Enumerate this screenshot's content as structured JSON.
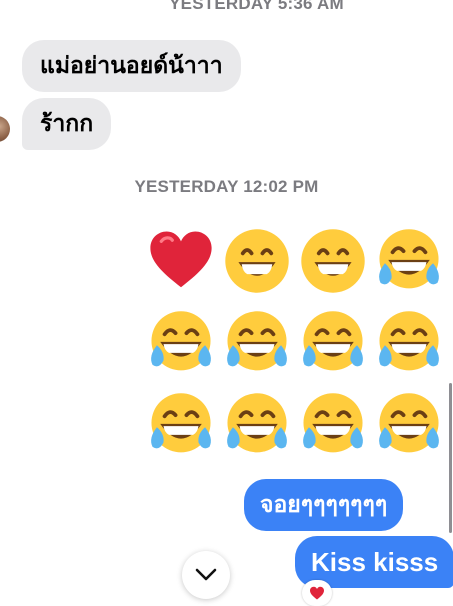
{
  "conversation": {
    "timestamps": [
      "YESTERDAY 5:36 AM",
      "YESTERDAY 12:02 PM"
    ],
    "incoming": [
      {
        "text": "แม่อย่านอยด์น้าาา"
      },
      {
        "text": "ร้ากก"
      }
    ],
    "emoji_rows": [
      [
        "heart",
        "grinning-face",
        "grinning-face",
        "tears-of-joy-face"
      ],
      [
        "tears-of-joy-face",
        "tears-of-joy-face",
        "tears-of-joy-face",
        "tears-of-joy-face"
      ],
      [
        "tears-of-joy-face",
        "tears-of-joy-face",
        "tears-of-joy-face",
        "tears-of-joy-face"
      ]
    ],
    "outgoing": [
      {
        "text": "จอยๆๆๆๆๆๆๆ"
      },
      {
        "text": "Kiss kisss"
      }
    ],
    "reaction": "heart"
  },
  "controls": {
    "scroll_down_icon": "chevron-down-icon"
  },
  "colors": {
    "incoming_bubble": "#e9e9eb",
    "outgoing_bubble": "#3b82f6",
    "timestamp": "#7b7b80",
    "heart": "#e0243a",
    "emoji_face": "#ffcc3d"
  }
}
